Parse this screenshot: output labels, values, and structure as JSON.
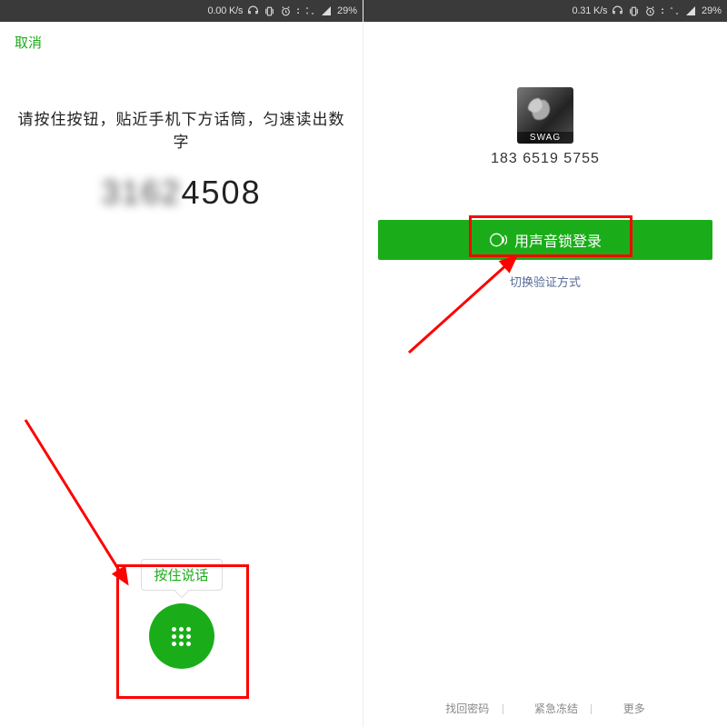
{
  "status": {
    "left_speed": "0.00 K/s",
    "right_speed": "0.31 K/s",
    "battery": "29%"
  },
  "left": {
    "cancel": "取消",
    "instruction": "请按住按钮，贴近手机下方话筒，匀速读出数字",
    "digits_blurred": "3162",
    "digits_clear": "4508",
    "hold_label": "按住说话"
  },
  "right": {
    "avatar_caption": "SWAG",
    "phone": "183 6519 5755",
    "voice_login_label": "用声音锁登录",
    "switch_method": "切换验证方式",
    "footer": {
      "find_pwd": "找回密码",
      "freeze": "紧急冻结",
      "more": "更多"
    }
  },
  "colors": {
    "green": "#1aad19",
    "link": "#576b95",
    "red": "#ff0000"
  }
}
